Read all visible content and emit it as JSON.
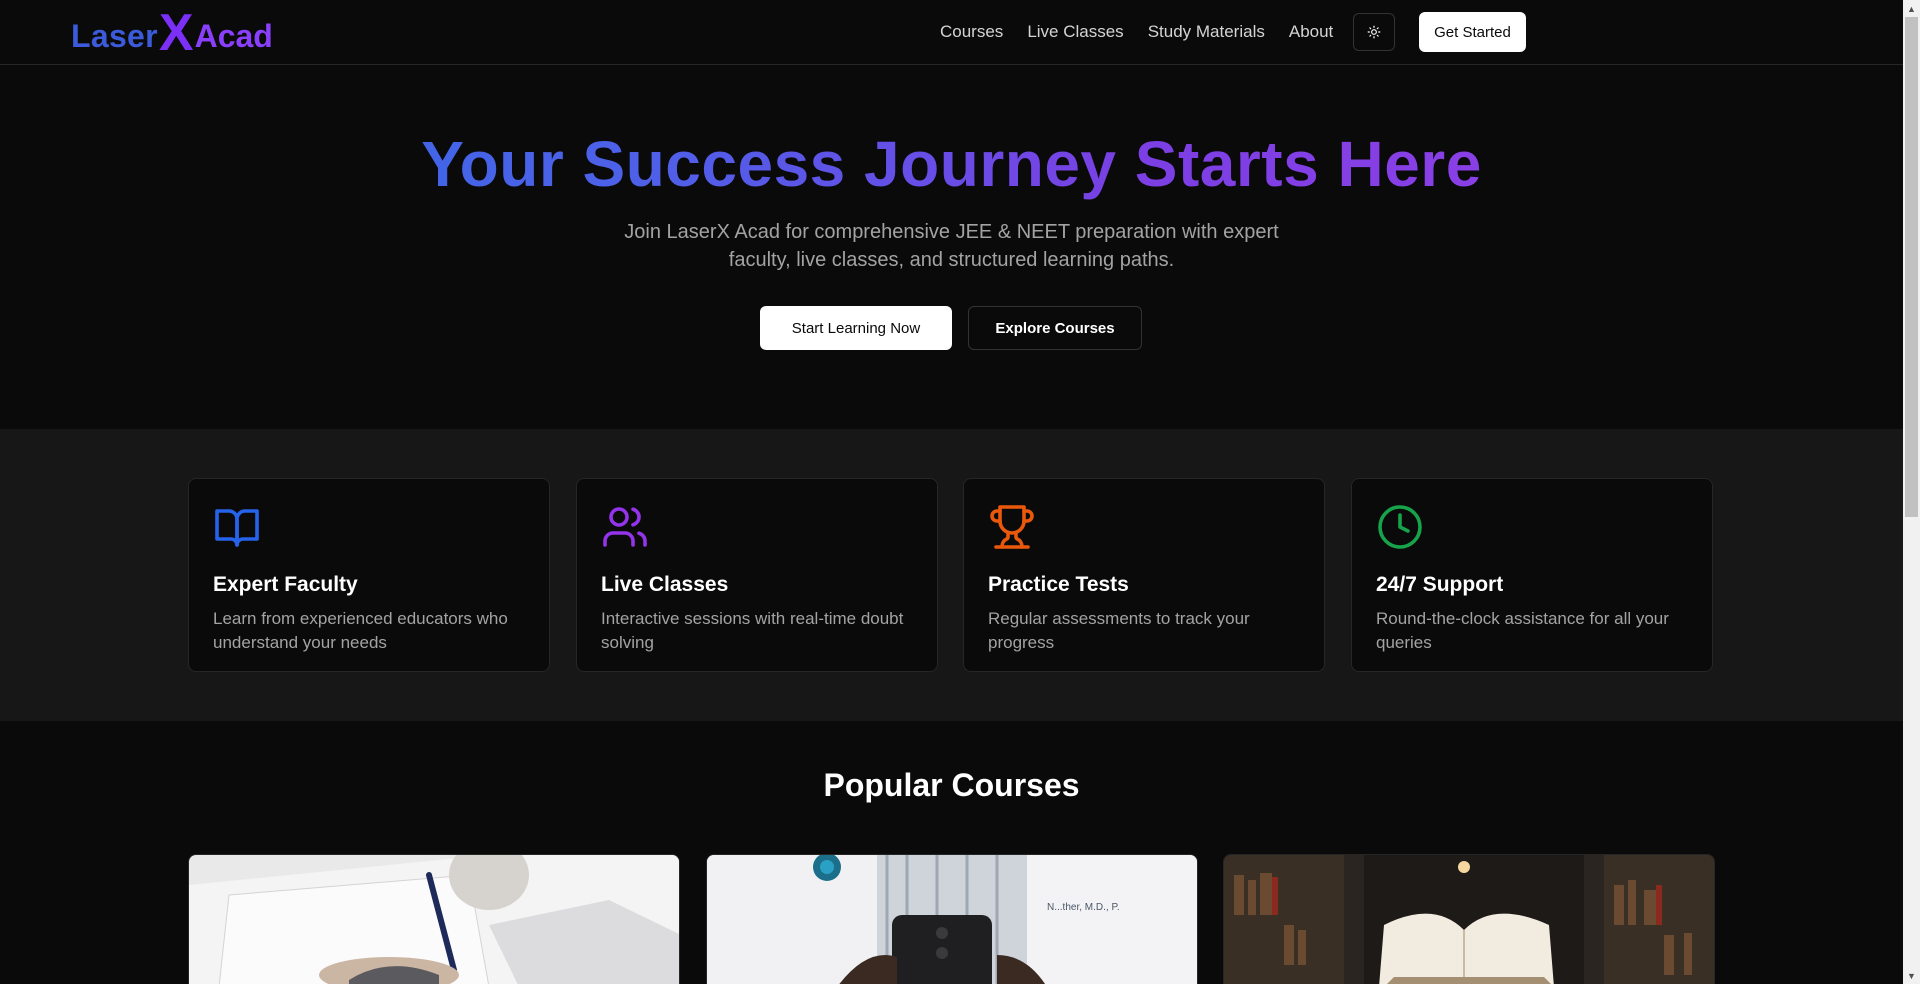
{
  "brand": {
    "part1": "Laser",
    "x": "X",
    "part2": "Acad"
  },
  "nav": {
    "items": [
      {
        "label": "Courses"
      },
      {
        "label": "Live Classes"
      },
      {
        "label": "Study Materials"
      },
      {
        "label": "About"
      }
    ],
    "theme_icon": "sun-icon",
    "cta_label": "Get Started"
  },
  "hero": {
    "title": "Your Success Journey Starts Here",
    "subtitle": "Join LaserX Acad for comprehensive JEE & NEET preparation with expert faculty, live classes, and structured learning paths.",
    "primary_label": "Start Learning Now",
    "secondary_label": "Explore Courses"
  },
  "features": [
    {
      "icon": "book-open-icon",
      "color": "#2563eb",
      "title": "Expert Faculty",
      "desc": "Learn from experienced educators who understand your needs"
    },
    {
      "icon": "users-icon",
      "color": "#9333ea",
      "title": "Live Classes",
      "desc": "Interactive sessions with real-time doubt solving"
    },
    {
      "icon": "trophy-icon",
      "color": "#ea580c",
      "title": "Practice Tests",
      "desc": "Regular assessments to track your progress"
    },
    {
      "icon": "clock-icon",
      "color": "#16a34a",
      "title": "24/7 Support",
      "desc": "Round-the-clock assistance for all your queries"
    }
  ],
  "courses": {
    "title": "Popular Courses",
    "images": [
      {
        "name": "course-image-writing"
      },
      {
        "name": "course-image-doctor"
      },
      {
        "name": "course-image-library"
      }
    ]
  }
}
